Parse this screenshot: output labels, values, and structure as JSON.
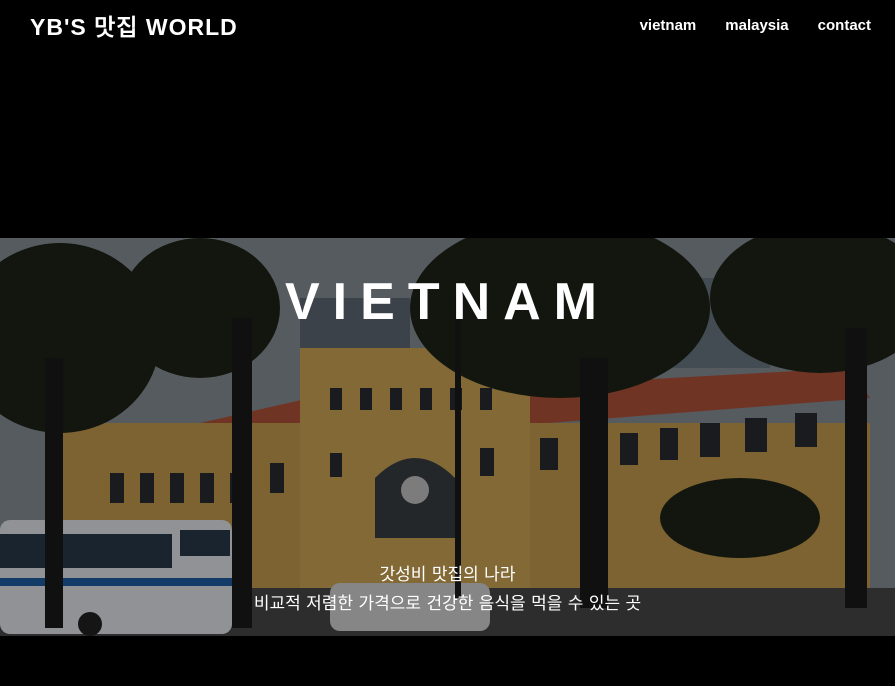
{
  "brand": {
    "title": "YB'S 맛집 WORLD"
  },
  "nav": {
    "items": [
      {
        "label": "vietnam"
      },
      {
        "label": "malaysia"
      },
      {
        "label": "contact"
      }
    ]
  },
  "hero": {
    "title": "VIETNAM",
    "subtitle_line1": "갓성비 맛집의 나라",
    "subtitle_line2": "비교적 저렴한 가격으로 건강한 음식을 먹을 수 있는 곳",
    "image_alt": "Saigon Central Post Office"
  },
  "colors": {
    "background": "#000000",
    "text": "#ffffff",
    "building": "#c9a04f",
    "roof": "#b5553a",
    "sky": "#8b949c"
  }
}
